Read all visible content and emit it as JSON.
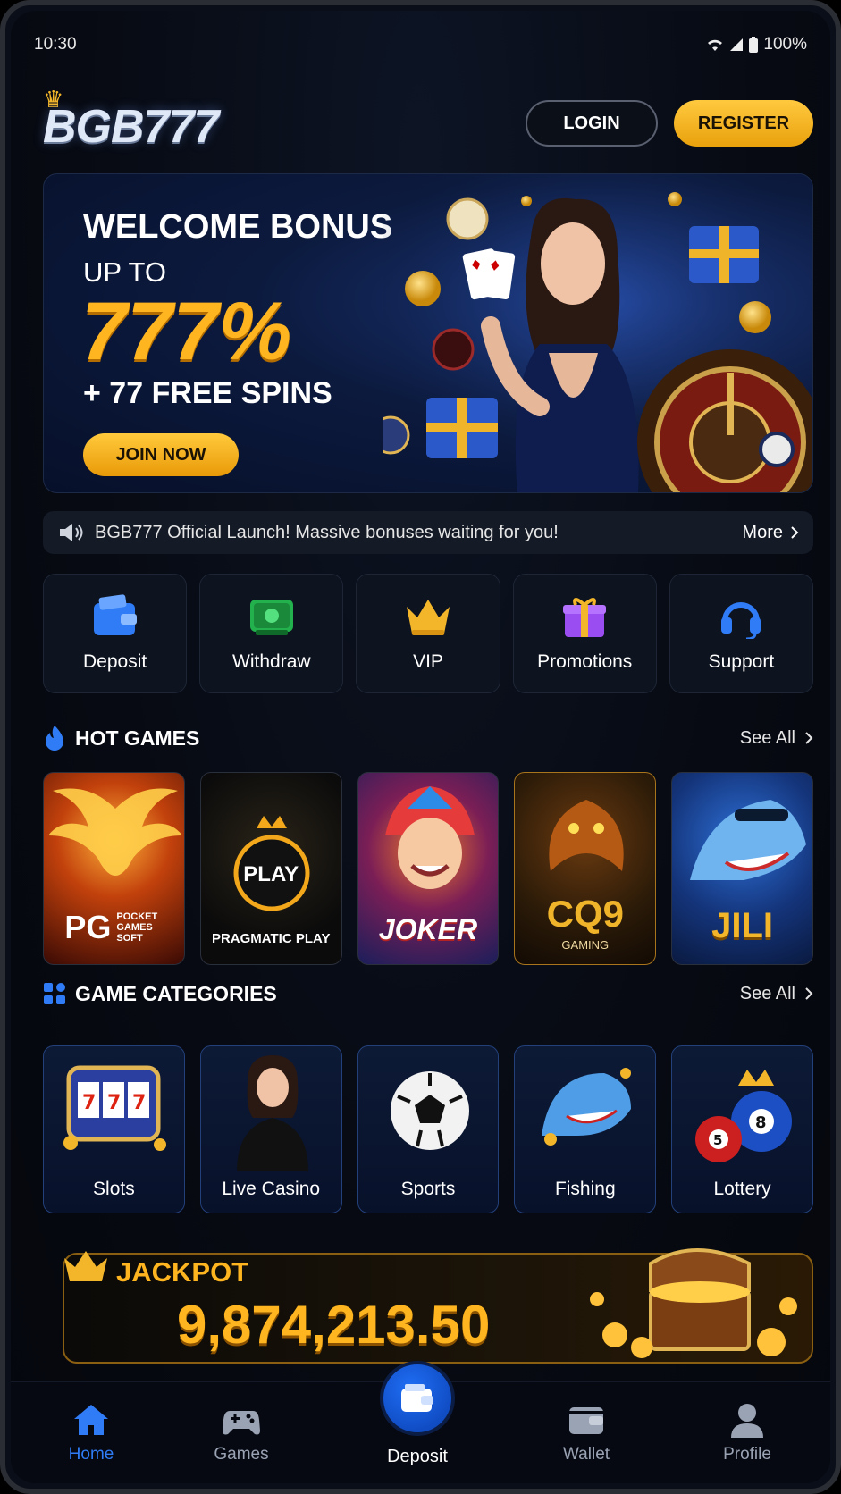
{
  "status": {
    "time": "10:30",
    "battery": "100%"
  },
  "header": {
    "logo": "BGB777",
    "login": "LOGIN",
    "register": "REGISTER"
  },
  "banner": {
    "title": "WELCOME BONUS",
    "upto": "UP TO",
    "percent": "777%",
    "spins": "+ 77 FREE SPINS",
    "cta": "JOIN NOW"
  },
  "marquee": {
    "text": "BGB777 Official Launch! Massive bonuses waiting for you!",
    "more": "More"
  },
  "quick_actions": [
    {
      "label": "Deposit",
      "icon": "wallet-icon"
    },
    {
      "label": "Withdraw",
      "icon": "cash-icon"
    },
    {
      "label": "VIP",
      "icon": "crown-icon"
    },
    {
      "label": "Promotions",
      "icon": "gift-icon"
    },
    {
      "label": "Support",
      "icon": "headset-icon"
    }
  ],
  "hot_games": {
    "title": "HOT GAMES",
    "see_all": "See All",
    "items": [
      {
        "name": "PG",
        "sub": "POCKET GAMES SOFT"
      },
      {
        "name": "PLAY",
        "sub": "PRAGMATIC PLAY"
      },
      {
        "name": "JOKER",
        "sub": ""
      },
      {
        "name": "CQ9",
        "sub": "GAMING"
      },
      {
        "name": "JILI",
        "sub": ""
      }
    ]
  },
  "categories": {
    "title": "GAME CATEGORIES",
    "see_all": "See All",
    "items": [
      {
        "label": "Slots"
      },
      {
        "label": "Live Casino"
      },
      {
        "label": "Sports"
      },
      {
        "label": "Fishing"
      },
      {
        "label": "Lottery"
      }
    ]
  },
  "jackpot": {
    "label": "JACKPOT",
    "value": "9,874,213.50"
  },
  "bottom_nav": {
    "home": "Home",
    "games": "Games",
    "deposit": "Deposit",
    "wallet": "Wallet",
    "profile": "Profile"
  },
  "colors": {
    "gold": "#ffb51f",
    "accent_blue": "#2f7cf6",
    "background": "#070a12"
  }
}
